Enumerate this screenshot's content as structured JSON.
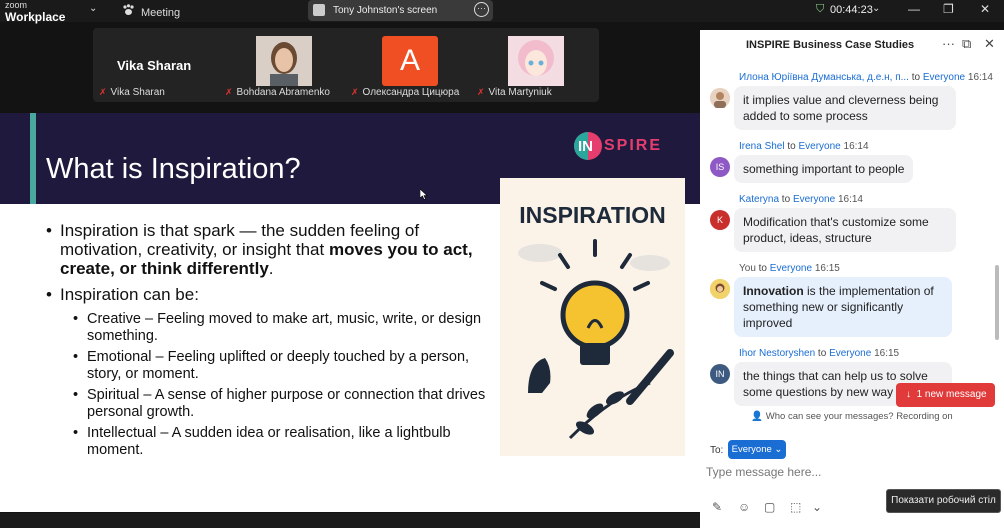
{
  "topbar": {
    "brand_line1": "zoom",
    "brand_line2": "Workplace",
    "meeting_label": "Meeting",
    "screen_share_label": "Tony Johnston's screen",
    "timer": "00:44:23"
  },
  "participants": [
    {
      "display": "Vika Sharan",
      "name": "Vika Sharan",
      "kind": "text"
    },
    {
      "display": "",
      "name": "Bohdana Abramenko",
      "kind": "photo"
    },
    {
      "display": "A",
      "name": "Олександра Цицюра",
      "kind": "letter"
    },
    {
      "display": "",
      "name": "Vita Martyniuk",
      "kind": "anime"
    }
  ],
  "slide": {
    "title": "What is Inspiration?",
    "logo_in": "IN",
    "logo_rest": "SPIRE",
    "bullet1_text": "Inspiration is that spark — the sudden feeling of motivation, creativity, or insight that ",
    "bullet1_bold": "moves you to act, create, or think differently",
    "bullet1_end": ".",
    "bullet2": "Inspiration can be:",
    "subs": [
      "Creative – Feeling moved to make art, music, write, or design something.",
      "Emotional – Feeling uplifted or deeply touched by a person, story, or moment.",
      "Spiritual – A sense of higher purpose or connection that drives personal growth.",
      "Intellectual – A sudden idea or realisation, like a lightbulb moment."
    ],
    "poster_title": "INSPIRATION"
  },
  "chat": {
    "title": "INSPIRE Business Case Studies",
    "messages": [
      {
        "sender": "Илона Юріївна Думанська, д.е.н, п...",
        "to": " to ",
        "recipient": "Everyone",
        "time": "16:14",
        "avatar": "",
        "text": "it implies value and cleverness being added to some process"
      },
      {
        "sender": "Irena Shel",
        "to": " to ",
        "recipient": "Everyone",
        "time": "16:14",
        "avatar": "IS",
        "text": "something important to people"
      },
      {
        "sender": "Kateryna",
        "to": " to ",
        "recipient": "Everyone",
        "time": "16:14",
        "avatar": "K",
        "text": "Modification that's customize some product, ideas, structure"
      },
      {
        "sender": "You",
        "to": " to ",
        "recipient": "Everyone",
        "time": "16:15",
        "avatar": "",
        "bold": "Innovation",
        "text": " is the implementation of something new or significantly improved"
      },
      {
        "sender": "Ihor Nestoryshen",
        "to": " to ",
        "recipient": "Everyone",
        "time": "16:15",
        "avatar": "IN",
        "text": "the things that can help us to solve some questions by new way"
      }
    ],
    "new_message_label": "1 new message",
    "privacy_text": "Who can see your messages? Recording on",
    "to_label": "To:",
    "to_value": "Everyone",
    "input_placeholder": "Type message here...",
    "tooltip": "Показати робочий стіл"
  },
  "colors": {
    "slide_header": "#1f1a3d",
    "accent_teal": "#4aa99f",
    "logo_pink": "#e63d6f",
    "link_blue": "#1a6dd3",
    "alert_red": "#e03a3a"
  }
}
